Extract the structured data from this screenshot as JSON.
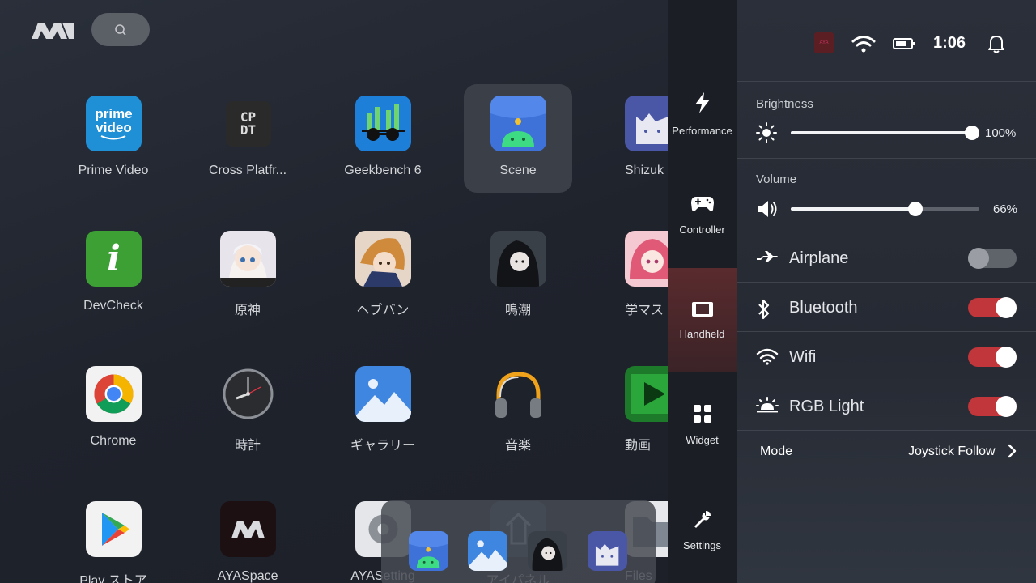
{
  "launcher": {
    "apps": [
      {
        "label": "Prime Video",
        "icon": "prime-video-icon",
        "selected": false
      },
      {
        "label": "Cross Platfr...",
        "icon": "cpdt-icon",
        "selected": false
      },
      {
        "label": "Geekbench 6",
        "icon": "geekbench-icon",
        "selected": false
      },
      {
        "label": "Scene",
        "icon": "scene-icon",
        "selected": true
      },
      {
        "label": "Shizuk",
        "icon": "shizuku-icon",
        "selected": false
      },
      {
        "label": "DevCheck",
        "icon": "devcheck-icon",
        "selected": false
      },
      {
        "label": "原神",
        "icon": "genshin-icon",
        "selected": false
      },
      {
        "label": "ヘブバン",
        "icon": "heaven-burns-icon",
        "selected": false
      },
      {
        "label": "鳴潮",
        "icon": "wuthering-waves-icon",
        "selected": false
      },
      {
        "label": "学マス",
        "icon": "gakumas-icon",
        "selected": false
      },
      {
        "label": "Chrome",
        "icon": "chrome-icon",
        "selected": false
      },
      {
        "label": "時計",
        "icon": "clock-icon",
        "selected": false
      },
      {
        "label": "ギャラリー",
        "icon": "gallery-icon",
        "selected": false
      },
      {
        "label": "音楽",
        "icon": "music-icon",
        "selected": false
      },
      {
        "label": "動画",
        "icon": "video-icon",
        "selected": false
      },
      {
        "label": "Play ストア",
        "icon": "play-store-icon",
        "selected": false
      },
      {
        "label": "AYASpace",
        "icon": "ayaspace-icon",
        "selected": false
      },
      {
        "label": "AYASetting",
        "icon": "settings-gear-icon",
        "selected": false
      },
      {
        "label": "アイパネル",
        "icon": "panel-icon",
        "selected": false
      },
      {
        "label": "Files",
        "icon": "files-icon",
        "selected": false
      }
    ],
    "dock": [
      "scene-icon",
      "gallery-icon",
      "wuthering-waves-icon",
      "shizuku-icon"
    ],
    "cpdt_text": "CP\nDT",
    "prime_text": "prime video"
  },
  "sidetabs": [
    {
      "label": "Performance",
      "icon": "lightning-icon",
      "active": false
    },
    {
      "label": "Controller",
      "icon": "gamepad-icon",
      "active": false
    },
    {
      "label": "Handheld",
      "icon": "handheld-icon",
      "active": true
    },
    {
      "label": "Widget",
      "icon": "widget-grid-icon",
      "active": false
    },
    {
      "label": "Settings",
      "icon": "wrench-icon",
      "active": false
    }
  ],
  "status": {
    "time": "1:06",
    "badge": "AYA"
  },
  "quick": {
    "brightness": {
      "title": "Brightness",
      "value": 100,
      "label": "100%"
    },
    "volume": {
      "title": "Volume",
      "value": 66,
      "label": "66%"
    },
    "toggles": [
      {
        "label": "Airplane",
        "on": false,
        "icon": "airplane-icon"
      },
      {
        "label": "Bluetooth",
        "on": true,
        "icon": "bluetooth-icon"
      },
      {
        "label": "Wifi",
        "on": true,
        "icon": "wifi-icon"
      },
      {
        "label": "RGB Light",
        "on": true,
        "icon": "rgb-light-icon"
      }
    ],
    "mode_label": "Mode",
    "mode_value": "Joystick Follow"
  },
  "colors": {
    "accent": "#c0363a",
    "active_tab": "#5a2b2e",
    "panel_bg": "#2a2f39"
  }
}
